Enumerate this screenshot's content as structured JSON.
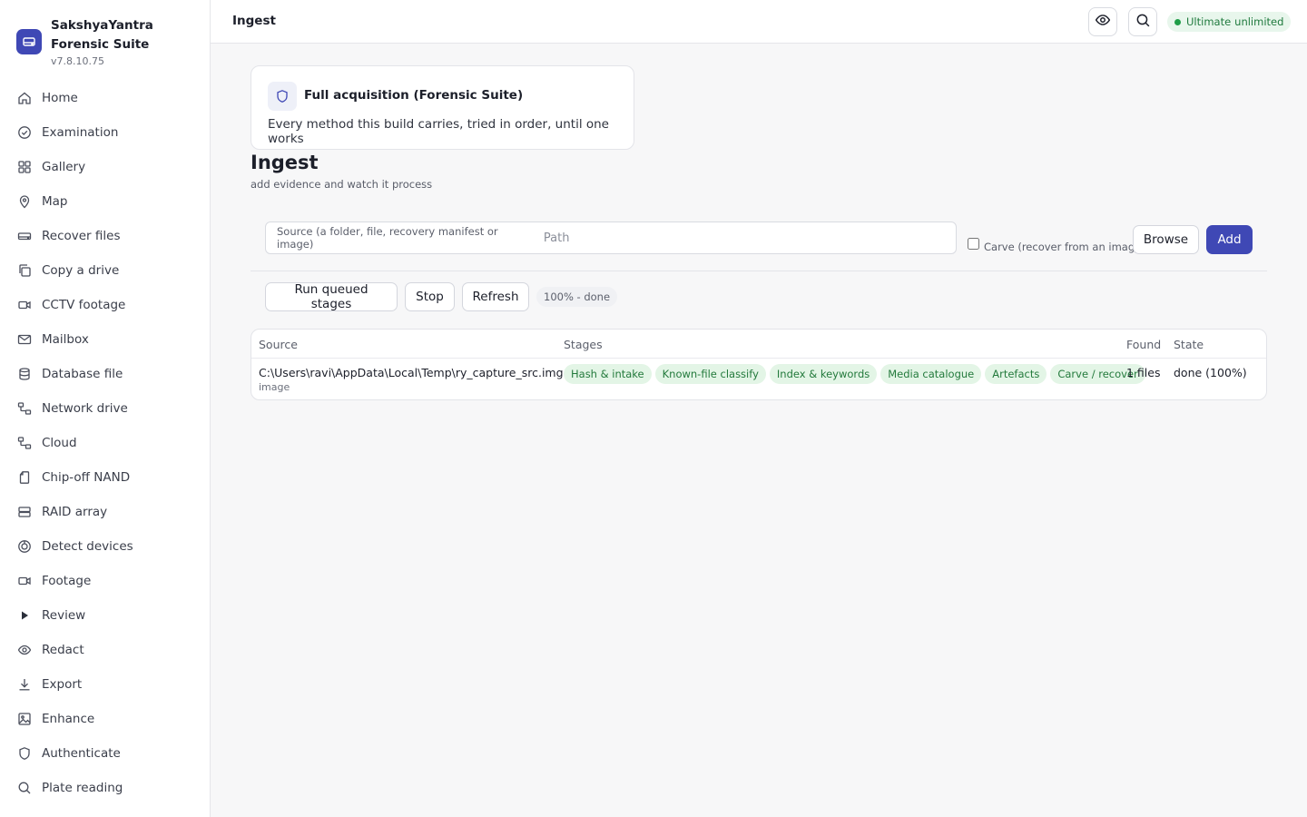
{
  "app": {
    "name": "SakshyaYantra Forensic Suite",
    "version": "v7.8.10.75"
  },
  "sidebar": {
    "items": [
      {
        "label": "Home",
        "icon": "home-icon"
      },
      {
        "label": "Examination",
        "icon": "check-circle-icon"
      },
      {
        "label": "Gallery",
        "icon": "grid-icon"
      },
      {
        "label": "Map",
        "icon": "map-pin-icon"
      },
      {
        "label": "Recover files",
        "icon": "hard-drive-icon"
      },
      {
        "label": "Copy a drive",
        "icon": "copy-icon"
      },
      {
        "label": "CCTV footage",
        "icon": "video-icon"
      },
      {
        "label": "Mailbox",
        "icon": "mail-icon"
      },
      {
        "label": "Database file",
        "icon": "database-icon"
      },
      {
        "label": "Network drive",
        "icon": "network-icon"
      },
      {
        "label": "Cloud",
        "icon": "cloud-network-icon"
      },
      {
        "label": "Chip-off NAND",
        "icon": "chip-file-icon"
      },
      {
        "label": "RAID array",
        "icon": "server-icon"
      },
      {
        "label": "Detect devices",
        "icon": "detect-icon"
      },
      {
        "label": "Footage",
        "icon": "video-icon"
      },
      {
        "label": "Review",
        "icon": "play-icon"
      },
      {
        "label": "Redact",
        "icon": "eye-icon"
      },
      {
        "label": "Export",
        "icon": "download-icon"
      },
      {
        "label": "Enhance",
        "icon": "image-icon"
      },
      {
        "label": "Authenticate",
        "icon": "shield-icon"
      },
      {
        "label": "Plate reading",
        "icon": "search-icon"
      }
    ]
  },
  "topbar": {
    "title": "Ingest",
    "plan_badge": "Ultimate",
    "plan_detail": "unlimited"
  },
  "method_card": {
    "title": "Full acquisition (Forensic Suite)",
    "description": "Every method this build carries, tried in order, until one works"
  },
  "page": {
    "title": "Ingest",
    "subtitle": "add evidence and watch it process"
  },
  "source": {
    "label": "Source (a folder, file, recovery manifest or image)",
    "placeholder": "Path",
    "value": "",
    "carve_label": "Carve (recover from an image)",
    "carve_checked": false,
    "browse_label": "Browse",
    "add_label": "Add"
  },
  "controls": {
    "run_label": "Run queued stages",
    "stop_label": "Stop",
    "refresh_label": "Refresh",
    "status": "100% - done"
  },
  "table": {
    "headers": {
      "source": "Source",
      "stages": "Stages",
      "found": "Found",
      "state": "State"
    },
    "rows": [
      {
        "source": "C:\\Users\\ravi\\AppData\\Local\\Temp\\ry_capture_src.img",
        "kind": "image",
        "stages": [
          "Hash & intake",
          "Known-file classify",
          "Index & keywords",
          "Media catalogue",
          "Artefacts",
          "Carve / recover"
        ],
        "found": "1 files",
        "state": "done (100%)"
      }
    ]
  },
  "colors": {
    "accent": "#3f48b5",
    "success_bg": "#e3f5e6",
    "success_text": "#237a3c"
  }
}
